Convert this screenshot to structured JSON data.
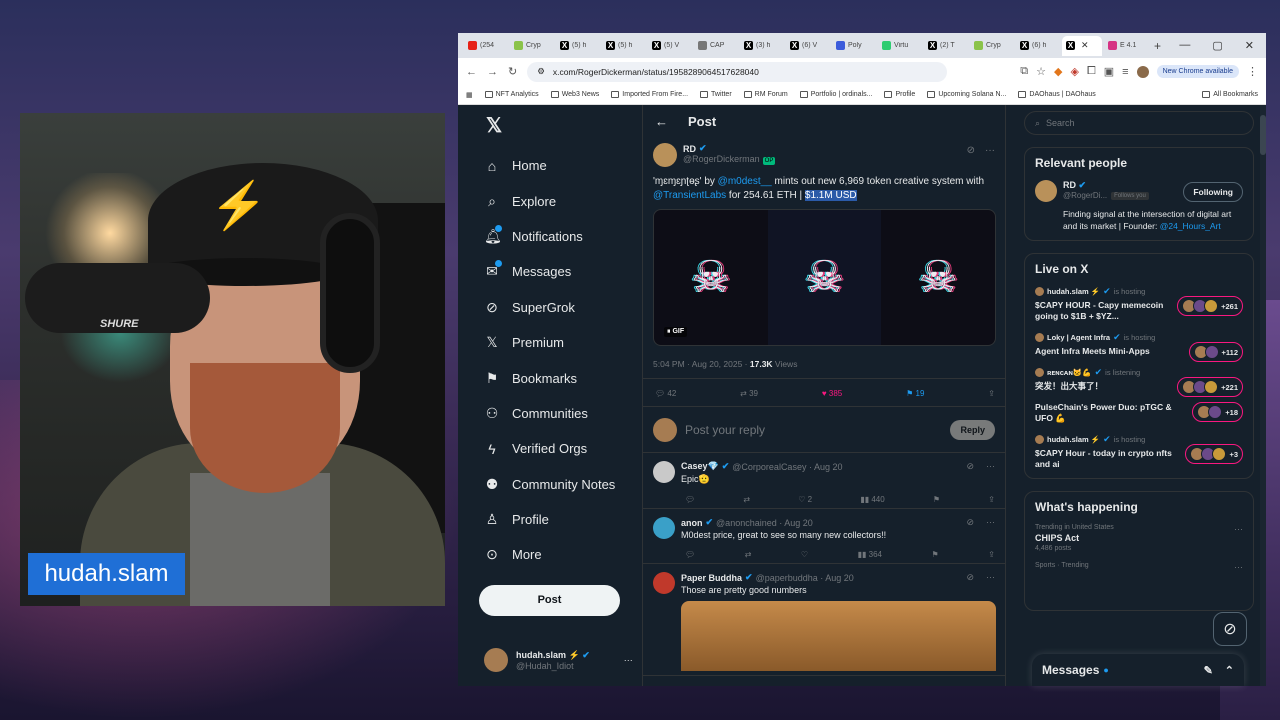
{
  "streamer": {
    "name_tag": "hudah.slam",
    "mic_brand": "SHURE"
  },
  "browser": {
    "tabs": [
      {
        "title": "(254",
        "color": "#e62117",
        "icon": "youtube-icon"
      },
      {
        "title": "Cryp",
        "color": "#8bc34a",
        "icon": "site-icon"
      },
      {
        "title": "(5) h",
        "color": "#000000",
        "icon": "x-icon"
      },
      {
        "title": "(5) h",
        "color": "#000000",
        "icon": "x-icon"
      },
      {
        "title": "(5) V",
        "color": "#000000",
        "icon": "x-icon"
      },
      {
        "title": "CAP",
        "color": "#777777",
        "icon": "site-icon"
      },
      {
        "title": "(3) h",
        "color": "#000000",
        "icon": "x-icon"
      },
      {
        "title": "(6) V",
        "color": "#000000",
        "icon": "x-icon"
      },
      {
        "title": "Poly",
        "color": "#3b5bdb",
        "icon": "site-icon"
      },
      {
        "title": "Virtu",
        "color": "#2ecc71",
        "icon": "site-icon"
      },
      {
        "title": "(2) T",
        "color": "#000000",
        "icon": "x-icon"
      },
      {
        "title": "Cryp",
        "color": "#8bc34a",
        "icon": "site-icon"
      },
      {
        "title": "(6) h",
        "color": "#000000",
        "icon": "x-icon"
      },
      {
        "title": "",
        "color": "#000000",
        "icon": "x-icon",
        "active": true
      },
      {
        "title": "E 4.1",
        "color": "#d63384",
        "icon": "site-icon"
      }
    ],
    "url": "x.com/RogerDickerman/status/1958289064517628040",
    "new_chrome": "New Chrome available",
    "bookmarks": [
      "NFT Analytics",
      "Web3 News",
      "Imported From Fire...",
      "Twitter",
      "RM Forum",
      "Portfolio | ordinals...",
      "Profile",
      "Upcoming Solana N...",
      "DAOhaus | DAOhaus"
    ],
    "all_bookmarks": "All Bookmarks"
  },
  "nav": {
    "items": [
      {
        "label": "Home",
        "icon": "home-icon",
        "glyph": "⌂"
      },
      {
        "label": "Explore",
        "icon": "search-icon",
        "glyph": "⌕"
      },
      {
        "label": "Notifications",
        "icon": "bell-icon",
        "glyph": "🔔︎",
        "dot": true
      },
      {
        "label": "Messages",
        "icon": "mail-icon",
        "glyph": "✉",
        "dot": true
      },
      {
        "label": "SuperGrok",
        "icon": "grok-icon",
        "glyph": "⊘"
      },
      {
        "label": "Premium",
        "icon": "x-icon",
        "glyph": "𝕏"
      },
      {
        "label": "Bookmarks",
        "icon": "bookmark-icon",
        "glyph": "⚑"
      },
      {
        "label": "Communities",
        "icon": "people-icon",
        "glyph": "⚇"
      },
      {
        "label": "Verified Orgs",
        "icon": "lightning-icon",
        "glyph": "ϟ"
      },
      {
        "label": "Community Notes",
        "icon": "notes-icon",
        "glyph": "⚉"
      },
      {
        "label": "Profile",
        "icon": "person-icon",
        "glyph": "♙"
      },
      {
        "label": "More",
        "icon": "more-icon",
        "glyph": "⊙"
      }
    ],
    "post": "Post",
    "account": {
      "name": "hudah.slam ⚡",
      "handle": "@Hudah_Idiot"
    }
  },
  "post_header": "Post",
  "tweet": {
    "name": "RD",
    "handle": "@RogerDickerman",
    "op": "OP",
    "text_prefix": "'ɱɛɱɛɲʈɵʂ' by ",
    "mention1": "@m0dest__",
    "text_mid": " mints out new 6,969 token creative system with ",
    "mention2": "@TransientLabs",
    "text_after": " for 254.61 ETH | ",
    "highlight": "$1.1M USD",
    "gif": "GIF",
    "time": "5:04 PM · Aug 20, 2025 · ",
    "views": "17.3K",
    "views_label": " Views",
    "stats": {
      "replies": "42",
      "reposts": "39",
      "likes": "385",
      "bookmarks": "19"
    }
  },
  "reply_box": {
    "placeholder": "Post your reply",
    "button": "Reply"
  },
  "replies": [
    {
      "name": "Casey💎",
      "handle": "@CorporealCasey · Aug 20",
      "text": "Epic🫡",
      "reposts": "",
      "likes": "2",
      "views": "440",
      "color": "#c9c9c9"
    },
    {
      "name": "anon",
      "handle": "@anonchained · Aug 20",
      "text": "M0dest price, great to see so many new collectors!!",
      "reposts": "",
      "likes": "",
      "views": "364",
      "color": "#3aa0c8"
    },
    {
      "name": "Paper Buddha",
      "handle": "@paperbuddha · Aug 20",
      "text": "Those are pretty good numbers",
      "color": "#c0392b"
    }
  ],
  "right": {
    "search_placeholder": "Search",
    "relevant_title": "Relevant people",
    "rp": {
      "name": "RD",
      "handle": "@RogerDi...",
      "follows_you": "Follows you",
      "button": "Following",
      "bio": "Finding signal at the intersection of digital art and its market | Founder:",
      "bio_link": "@24_Hours_Art"
    },
    "live_title": "Live on X",
    "lives": [
      {
        "host": "hudah.slam ⚡",
        "status": "is hosting",
        "title": "$CAPY HOUR - Capy memecoin going to $1B + $YZ...",
        "count": "+261"
      },
      {
        "host": "Loky | Agent Infra",
        "status": "is hosting",
        "title": "Agent Infra Meets Mini-Apps",
        "count": "+112"
      },
      {
        "host": "ʀᴇɴᴄᴀɴ🐱💪",
        "status": "is listening",
        "title": "突发！出大事了！",
        "count": "+221"
      },
      {
        "host": "",
        "status": "",
        "title": "PulseChain's Power Duo: pTGC & UFO 💪",
        "count": "+18"
      },
      {
        "host": "hudah.slam ⚡",
        "status": "is hosting",
        "title": "$CAPY Hour - today in crypto nfts and ai",
        "count": "+3"
      }
    ],
    "happening_title": "What's happening",
    "trends": [
      {
        "cat": "Trending in United States",
        "title": "CHIPS Act",
        "count": "4,486 posts"
      },
      {
        "cat": "Sports · Trending",
        "title": "",
        "count": ""
      }
    ]
  },
  "messages_dock": "Messages"
}
